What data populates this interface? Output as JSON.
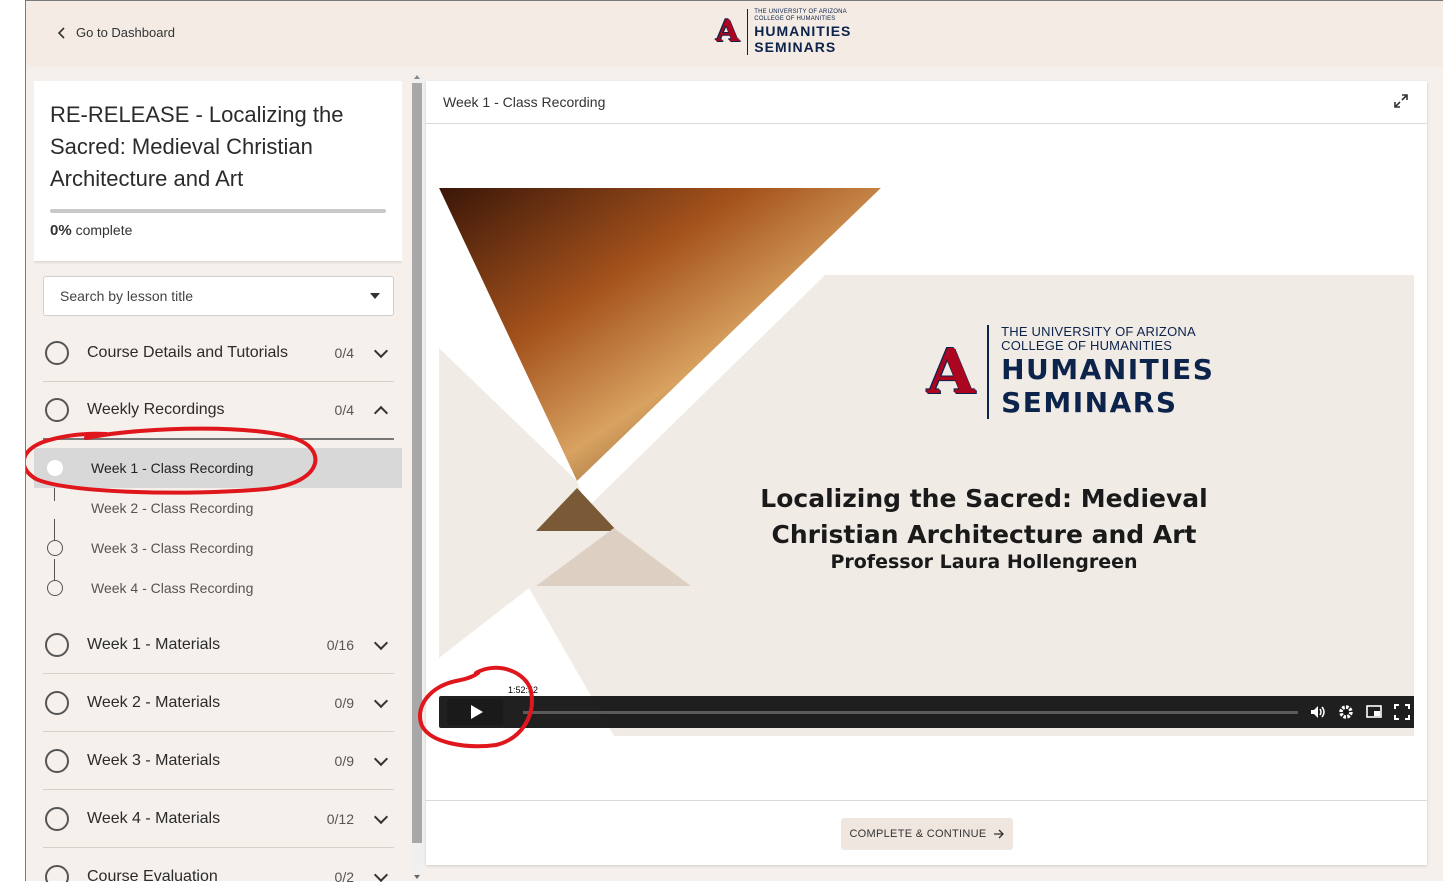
{
  "header": {
    "back_label": "Go to Dashboard",
    "logo_line1": "THE UNIVERSITY OF ARIZONA",
    "logo_line2": "COLLEGE OF HUMANITIES",
    "logo_big1": "HUMANITIES",
    "logo_big2": "SEMINARS"
  },
  "course": {
    "title": "RE-RELEASE - Localizing the Sacred: Medieval Christian Architecture and Art",
    "progress_percent": "0%",
    "progress_suffix": " complete",
    "progress_value": 0
  },
  "search": {
    "placeholder": "Search by lesson title"
  },
  "sections": [
    {
      "label": "Course Details and Tutorials",
      "count": "0/4"
    },
    {
      "label": "Weekly Recordings",
      "count": "0/4"
    },
    {
      "label": "Week 1 - Materials",
      "count": "0/16"
    },
    {
      "label": "Week 2 - Materials",
      "count": "0/9"
    },
    {
      "label": "Week 3 - Materials",
      "count": "0/9"
    },
    {
      "label": "Week 4 - Materials",
      "count": "0/12"
    },
    {
      "label": "Course Evaluation",
      "count": "0/2"
    }
  ],
  "lessons": [
    {
      "label": "Week 1 - Class Recording",
      "active": true
    },
    {
      "label": "Week 2 - Class Recording",
      "active": false
    },
    {
      "label": "Week 3 - Class Recording",
      "active": false
    },
    {
      "label": "Week 4 - Class Recording",
      "active": false
    }
  ],
  "main": {
    "header_title": "Week 1 - Class Recording",
    "slide": {
      "logo_line1": "THE UNIVERSITY OF ARIZONA",
      "logo_line2": "COLLEGE OF HUMANITIES",
      "logo_big1": "HUMANITIES",
      "logo_big2": "SEMINARS",
      "title_line1": "Localizing the Sacred: Medieval",
      "title_line2": "Christian Architecture and Art",
      "subtitle": "Professor Laura Hollengreen"
    },
    "player": {
      "duration": "1:52:52"
    },
    "continue_label": "COMPLETE & CONTINUE"
  },
  "icons": {
    "back": "chevron-left-icon",
    "expand": "expand-icon",
    "play": "play-icon",
    "volume": "volume-icon",
    "settings": "gear-icon",
    "pip": "picture-in-picture-icon",
    "fullscreen": "fullscreen-icon",
    "arrow": "arrow-right-icon"
  },
  "colors": {
    "brand_red": "#ab0520",
    "brand_navy": "#0c234b",
    "annotation": "#e0161d"
  }
}
